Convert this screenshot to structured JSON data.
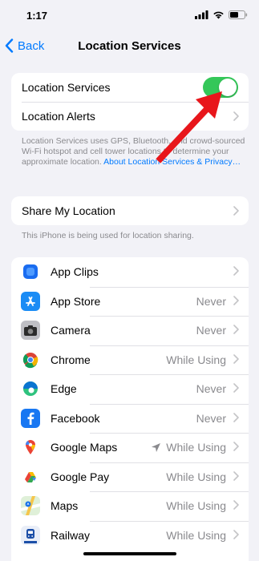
{
  "status": {
    "time": "1:17"
  },
  "nav": {
    "back_label": "Back",
    "title": "Location Services"
  },
  "top_group": {
    "location_services_label": "Location Services",
    "location_services_on": true,
    "location_alerts_label": "Location Alerts"
  },
  "description": {
    "text": "Location Services uses GPS, Bluetooth, and crowd-sourced Wi-Fi hotspot and cell tower locations to determine your approximate location. ",
    "link": "About Location Services & Privacy…"
  },
  "share": {
    "label": "Share My Location",
    "footnote": "This iPhone is being used for location sharing."
  },
  "apps": [
    {
      "name": "App Clips",
      "value": "",
      "icon": "app-clips-icon",
      "color": "#1a6cf0"
    },
    {
      "name": "App Store",
      "value": "Never",
      "icon": "app-store-icon",
      "color": "#1a8cf5"
    },
    {
      "name": "Camera",
      "value": "Never",
      "icon": "camera-icon",
      "color": "#b8b8bd"
    },
    {
      "name": "Chrome",
      "value": "While Using",
      "icon": "chrome-icon",
      "color": "#ffffff"
    },
    {
      "name": "Edge",
      "value": "Never",
      "icon": "edge-icon",
      "color": "#ffffff"
    },
    {
      "name": "Facebook",
      "value": "Never",
      "icon": "facebook-icon",
      "color": "#1877f2"
    },
    {
      "name": "Google Maps",
      "value": "While Using",
      "icon": "google-maps-icon",
      "color": "#ffffff",
      "location_arrow": true
    },
    {
      "name": "Google Pay",
      "value": "While Using",
      "icon": "google-pay-icon",
      "color": "#ffffff"
    },
    {
      "name": "Maps",
      "value": "While Using",
      "icon": "maps-icon",
      "color": "#6fcf6a"
    },
    {
      "name": "Railway",
      "value": "While Using",
      "icon": "railway-icon",
      "color": "#1c4fa8"
    }
  ],
  "colors": {
    "accent": "#007aff",
    "toggle_on": "#34c759",
    "annotation_arrow": "#e8161b"
  }
}
